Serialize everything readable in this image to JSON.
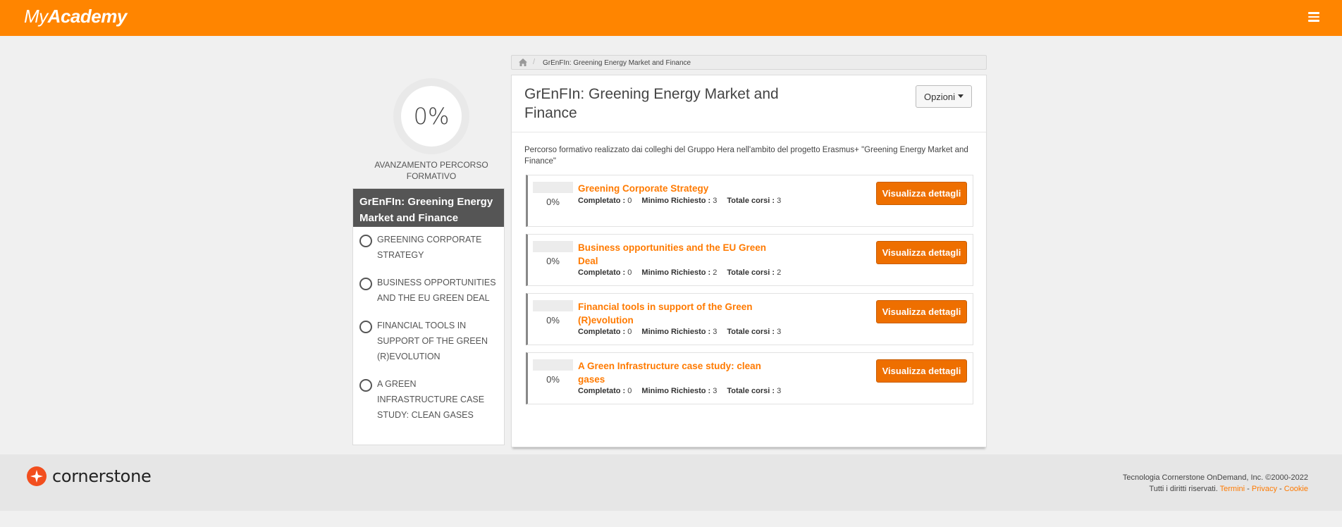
{
  "header": {
    "logo_my": "My",
    "logo_academy": "Academy",
    "brand_color": "#ff8500"
  },
  "sidebar": {
    "progress_value": "0%",
    "progress_caption": "AVANZAMENTO PERCORSO FORMATIVO",
    "heading": "GrEnFIn: Greening Energy Market and Finance",
    "items": [
      {
        "label": "GREENING CORPORATE STRATEGY"
      },
      {
        "label": "BUSINESS OPPORTUNITIES AND THE EU GREEN DEAL"
      },
      {
        "label": "FINANCIAL TOOLS IN SUPPORT OF THE GREEN (R)EVOLUTION"
      },
      {
        "label": "A GREEN INFRASTRUCTURE CASE STUDY: CLEAN GASES"
      }
    ]
  },
  "breadcrumb": {
    "home_icon": "home-icon",
    "current": "GrEnFIn: Greening Energy Market and Finance"
  },
  "main": {
    "title": "GrEnFIn: Greening Energy Market and Finance",
    "options_label": "Opzioni",
    "description": "Percorso formativo realizzato dai colleghi del Gruppo Hera nell'ambito del progetto Erasmus+ \"Greening Energy Market and Finance\"",
    "completed_label": "Completato :",
    "minimum_label": "Minimo Richiesto :",
    "total_label": "Totale corsi :",
    "button_label": "Visualizza dettagli",
    "courses": [
      {
        "title": "Greening Corporate Strategy",
        "progress": "0%",
        "completed": "0",
        "minimum": "3",
        "total": "3"
      },
      {
        "title": "Business opportunities and the EU Green Deal",
        "progress": "0%",
        "completed": "0",
        "minimum": "2",
        "total": "2"
      },
      {
        "title": "Financial tools in support of the Green (R)evolution",
        "progress": "0%",
        "completed": "0",
        "minimum": "3",
        "total": "3"
      },
      {
        "title": "A Green Infrastructure case study: clean gases",
        "progress": "0%",
        "completed": "0",
        "minimum": "3",
        "total": "3"
      }
    ]
  },
  "footer": {
    "brand": "cornerstone",
    "copyright": "Tecnologia Cornerstone OnDemand, Inc. ©2000-2022",
    "rights": "Tutti i diritti riservati.",
    "link_terms": "Termini",
    "link_privacy": "Privacy",
    "link_cookie": "Cookie",
    "separator": "-"
  }
}
